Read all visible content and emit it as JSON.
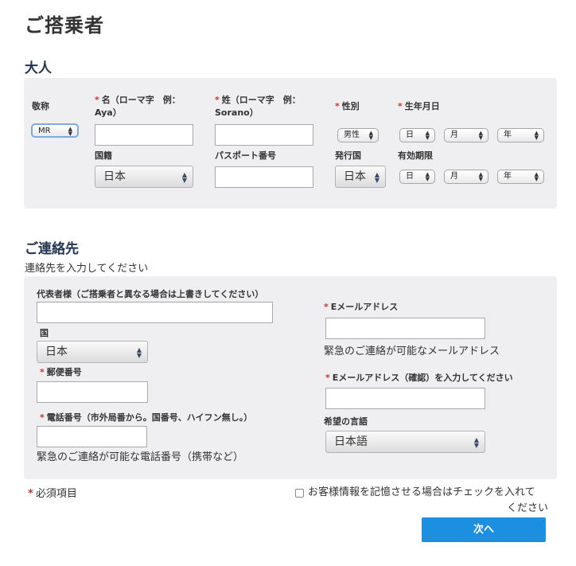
{
  "page_title": "ご搭乗者",
  "adult": {
    "heading": "大人",
    "title_label": "敬称",
    "title_value": "MR",
    "first_name_label": "名（ローマ字　例：Aya）",
    "last_name_label": "姓（ローマ字　例：Sorano）",
    "gender_label": "性別",
    "gender_value": "男性",
    "dob_label": "生年月日",
    "day_value": "日",
    "month_value": "月",
    "year_value": "年",
    "nationality_label": "国籍",
    "nationality_value": "日本",
    "passport_label": "パスポート番号",
    "issuing_country_label": "発行国",
    "issuing_country_value": "日本",
    "expiry_label": "有効期限",
    "required_mark": "*"
  },
  "contact": {
    "heading": "ご連絡先",
    "subtitle": "連絡先を入力してください",
    "representative_label": "代表者様（ご搭乗者と異なる場合は上書きしてください）",
    "country_label": "国",
    "country_value": "日本",
    "postal_label": "郵便番号",
    "phone_label": "電話番号（市外局番から。国番号、ハイフン無し。）",
    "phone_hint": "緊急のご連絡が可能な電話番号（携帯など）",
    "email_label": "Eメールアドレス",
    "email_hint": "緊急のご連絡が可能なメールアドレス",
    "email_confirm_label": "Eメールアドレス（確認）を入力してください",
    "language_label": "希望の言語",
    "language_value": "日本語"
  },
  "footer": {
    "required_note": "必須項目",
    "remember_line1": "お客様情報を記憶させる場合はチェックを入れて",
    "remember_line2": "ください",
    "next_button": "次へ"
  },
  "colors": {
    "panel_bg": "#efeff1",
    "heading_navy": "#24364f",
    "required_red": "#c0392b",
    "button_blue": "#1d8fe0"
  }
}
